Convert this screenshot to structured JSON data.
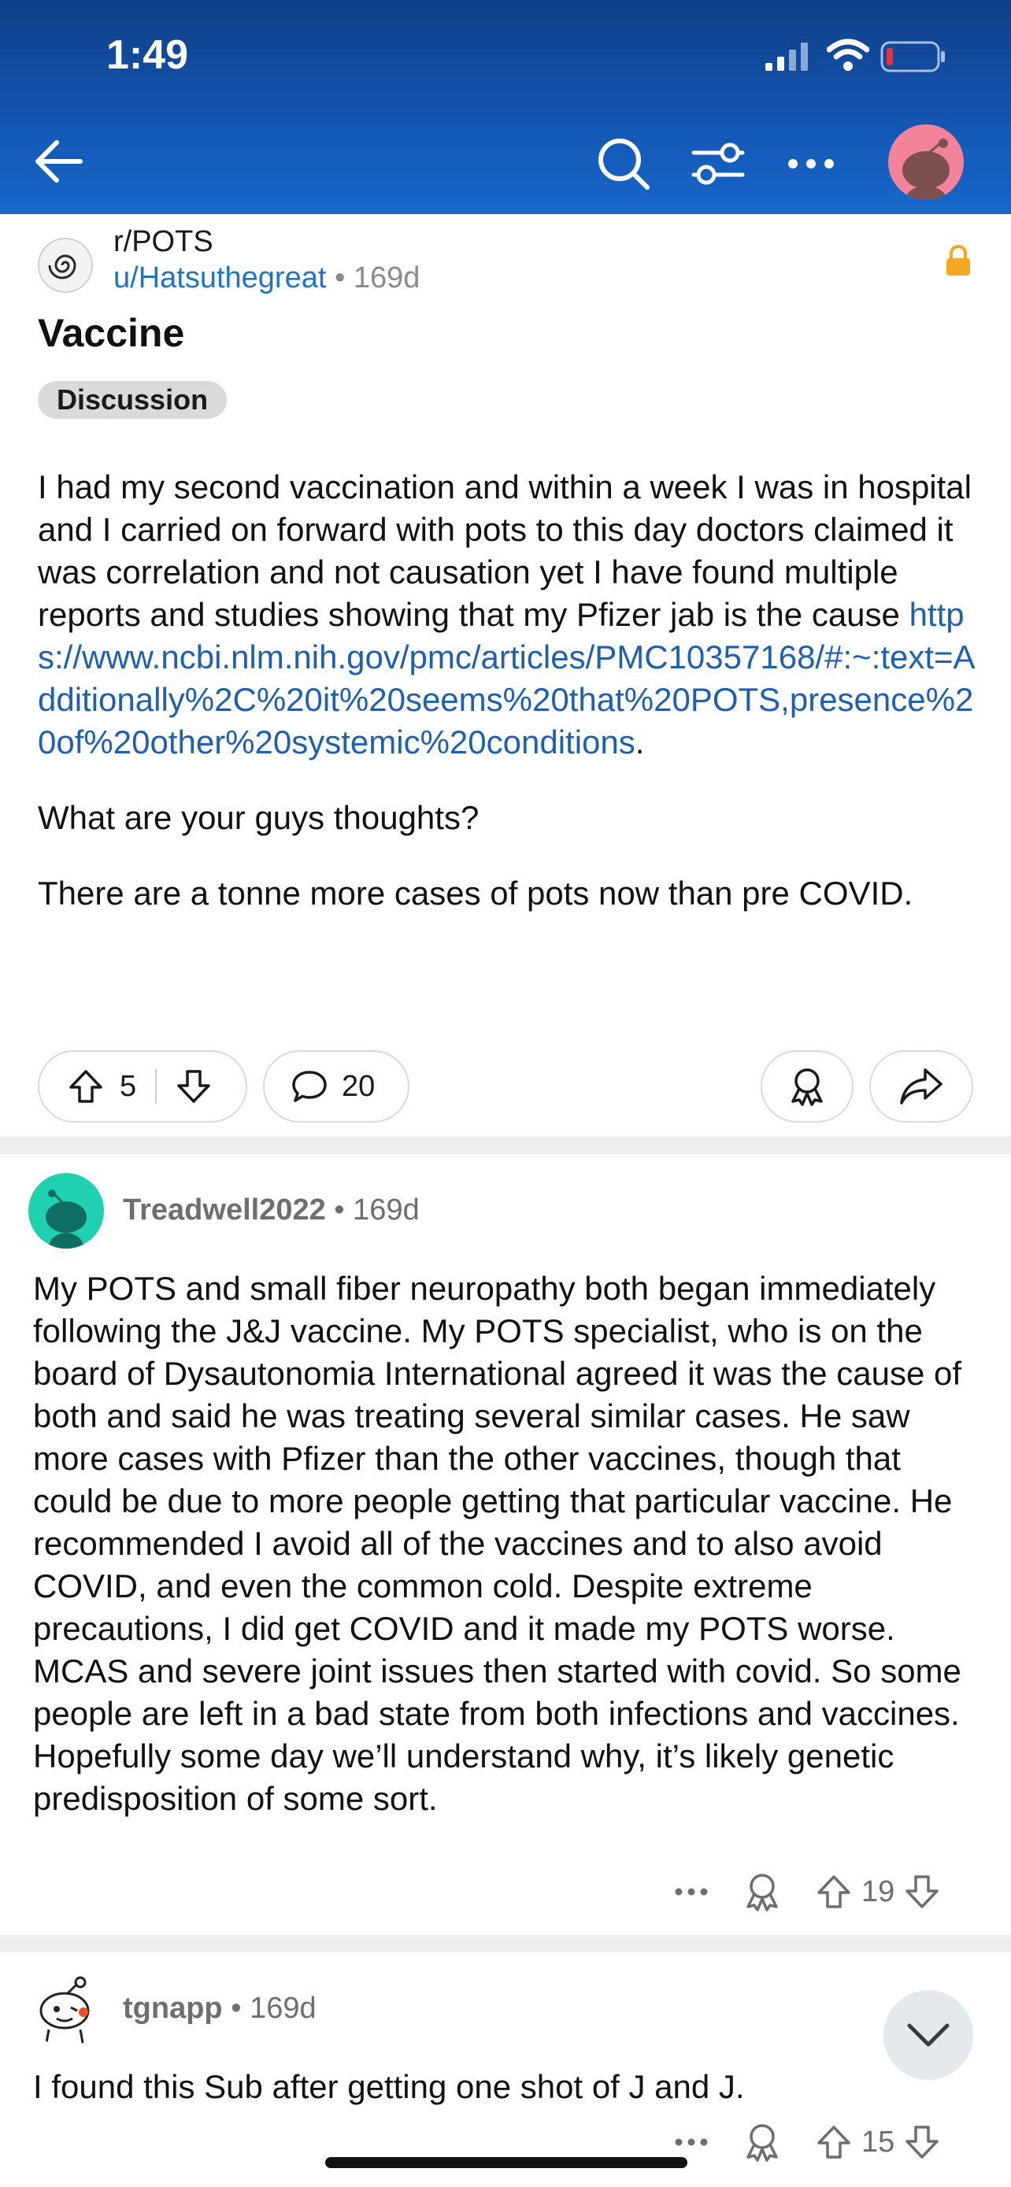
{
  "status_bar": {
    "time": "1:49"
  },
  "header": {
    "back_icon": "arrow-left-icon",
    "search_icon": "search-icon",
    "filter_icon": "sliders-icon",
    "more_icon": "more-horizontal-icon",
    "avatar_icon": "snoo-avatar-icon"
  },
  "post": {
    "subreddit": "r/POTS",
    "author": "u/Hatsuthegreat",
    "age": "169d",
    "title": "Vaccine",
    "flair": "Discussion",
    "body_lead": "I had my second vaccination and within a week I was in hospital and I carried on forward with pots to this day doctors claimed it was correlation and not causation yet I have found multiple reports and studies showing that my Pfizer jab is the cause ",
    "link": "https://www.ncbi.nlm.nih.gov/pmc/articles/PMC10357168/#:~:text=Additionally%2C%20it%20seems%20that%20POTS,presence%20of%20other%20systemic%20conditions",
    "body_tail": ".",
    "para2": "What are your guys thoughts?",
    "para3": "There are a tonne more cases of pots now than pre COVID.",
    "votes": "5",
    "comments": "20"
  },
  "comments": [
    {
      "author": "Treadwell2022",
      "age": "169d",
      "text": "My POTS and small fiber neuropathy both began immediately following the J&J vaccine. My POTS specialist, who is on the board of Dysautonomia International agreed it was the cause of both and said he was treating several similar cases. He saw more cases with Pfizer than the other vaccines, though that could be due to more people getting that particular vaccine. He recommended I avoid all of the vaccines and to also avoid COVID, and even the common cold.  Despite extreme precautions, I did get COVID and it made my POTS worse. MCAS and severe joint issues then started with covid.  So some people are left in a bad state from both infections and vaccines.  Hopefully some day we’ll understand why, it’s likely genetic predisposition of some sort.",
      "votes": "19"
    },
    {
      "author": "tgnapp",
      "age": "169d",
      "text": "I found this Sub after getting one shot of J and J.",
      "votes": "15"
    }
  ],
  "colors": {
    "header_blue": "#1457b5",
    "link_blue": "#1f5fae",
    "lock_orange": "#f5a623",
    "avatar_pink": "#f2839a",
    "avatar_teal": "#1fd1b0"
  }
}
